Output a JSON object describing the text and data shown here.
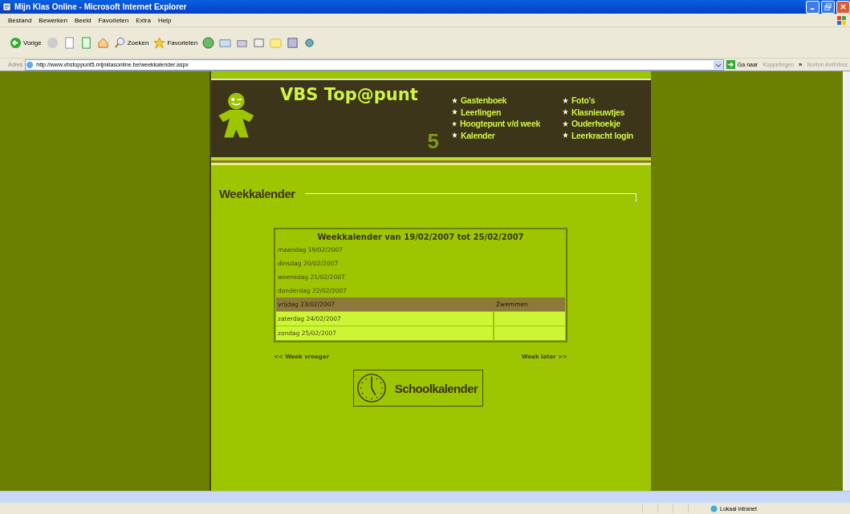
{
  "window": {
    "title": "Mijn Klas Online - Microsoft Internet Explorer"
  },
  "menu": [
    "Bestand",
    "Bewerken",
    "Beeld",
    "Favorieten",
    "Extra",
    "Help"
  ],
  "toolbar": [
    {
      "kind": "back",
      "label": "Vorige"
    },
    {
      "kind": "forward"
    },
    {
      "kind": "stop"
    },
    {
      "kind": "refresh"
    },
    {
      "kind": "home"
    },
    {
      "kind": "search",
      "label": "Zoeken"
    },
    {
      "kind": "favorites",
      "label": "Favorieten"
    },
    {
      "kind": "history"
    },
    {
      "kind": "mail"
    },
    {
      "kind": "print"
    },
    {
      "kind": "edit"
    },
    {
      "kind": "folder"
    },
    {
      "kind": "research"
    },
    {
      "kind": "messenger"
    }
  ],
  "address": {
    "label": "Adres",
    "url": "http://www.vbstoppunt5.mijnklasonline.be/weekkalender.aspx",
    "go": "Ga naar",
    "links": "Koppelingen",
    "chevron": "»",
    "antivirus": "Norton AntiVirus"
  },
  "site": {
    "title": "VBS Top@punt",
    "number": "5",
    "nav": [
      [
        "Gastenboek",
        "Leerlingen",
        "Hoogtepunt v/d week",
        "Kalender"
      ],
      [
        "Foto's",
        "Klasnieuwtjes",
        "Ouderhoekje",
        "Leerkracht login"
      ]
    ]
  },
  "heading": "Weekkalender",
  "calendar": {
    "title": "Weekkalender van 19/02/2007 tot 25/02/2007",
    "rows": [
      {
        "kind": "plain",
        "day": "maandag 19/02/2007"
      },
      {
        "kind": "plain",
        "day": "dinsdag 20/02/2007"
      },
      {
        "kind": "plain",
        "day": "woensdag 21/02/2007"
      },
      {
        "kind": "plain",
        "day": "donderdag 22/02/2007"
      },
      {
        "kind": "highlighted",
        "day": "vrijdag 23/02/2007",
        "note": "Zwemmen"
      },
      {
        "kind": "boxed",
        "day": "zaterdag 24/02/2007"
      },
      {
        "kind": "boxed",
        "day": "zondag 25/02/2007"
      }
    ]
  },
  "prev": "<< Week vroeger",
  "next": "Week later >>",
  "school_button": "Schoolkalender",
  "status": {
    "zone": "Lokaal intranet"
  }
}
